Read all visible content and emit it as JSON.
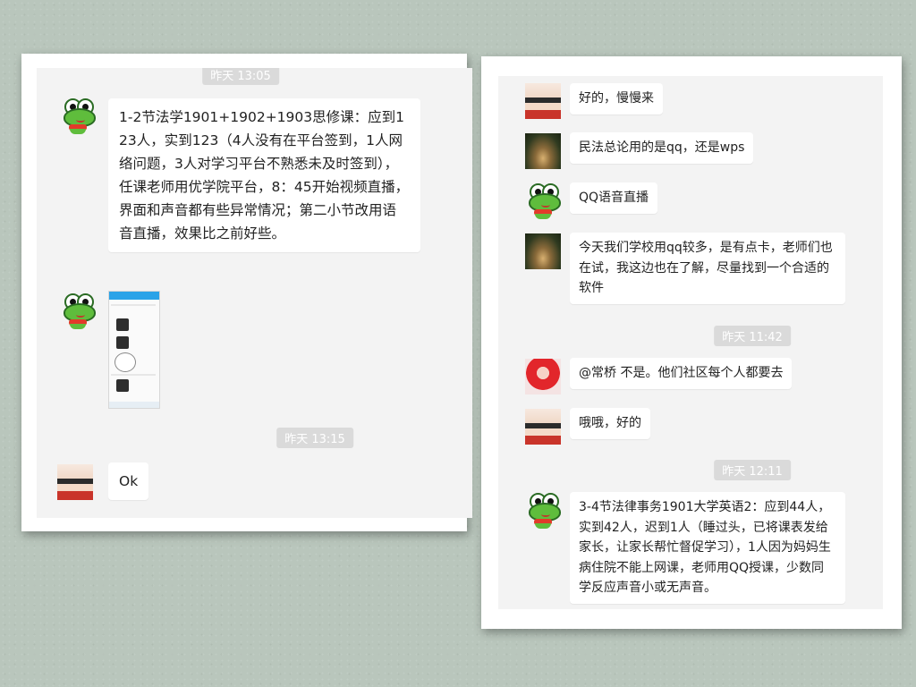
{
  "left": {
    "ts_top": "昨天 13:05",
    "msg1": "1-2节法学1901+1902+1903思修课：应到123人，实到123（4人没有在平台签到，1人网络问题，3人对学习平台不熟悉未及时签到），任课老师用优学院平台，8：45开始视频直播，界面和声音都有些异常情况；第二小节改用语音直播，效果比之前好些。",
    "ts2": "昨天 13:15",
    "msg3": "Ok"
  },
  "right": {
    "msg1": "好的，慢慢来",
    "msg2": "民法总论用的是qq，还是wps",
    "msg3": "QQ语音直播",
    "msg4": "今天我们学校用qq较多，是有点卡，老师们也在试，我这边也在了解，尽量找到一个合适的软件",
    "ts1": "昨天 11:42",
    "msg5": "@常桥 不是。他们社区每个人都要去",
    "msg6": "哦哦，好的",
    "ts2": "昨天 12:11",
    "msg7": "3-4节法律事务1901大学英语2：应到44人，实到42人，迟到1人（睡过头，已将课表发给家长，让家长帮忙督促学习），1人因为妈妈生病住院不能上网课，老师用QQ授课，少数同学反应声音小或无声音。"
  },
  "colors": {
    "background": "#b9c6bc",
    "panel": "#f3f3f3",
    "bubble": "#ffffff",
    "timestamp_bg": "#dadada"
  }
}
